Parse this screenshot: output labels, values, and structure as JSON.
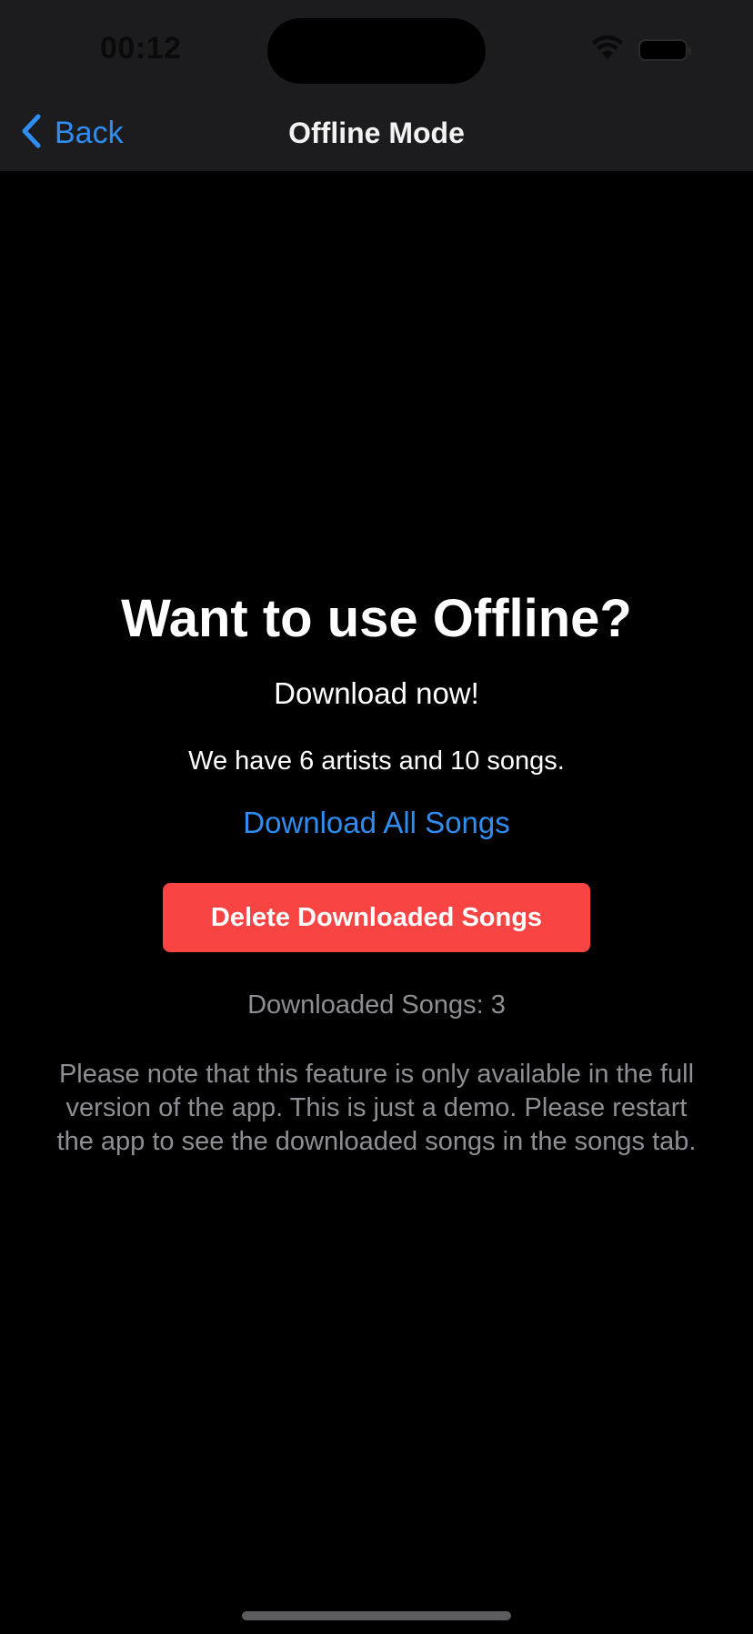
{
  "status_bar": {
    "time": "00:12",
    "icons": [
      "wifi-icon",
      "battery-icon"
    ]
  },
  "navbar": {
    "back_label": "Back",
    "back_icon": "chevron-left-icon",
    "title": "Offline Mode"
  },
  "main": {
    "headline": "Want to use Offline?",
    "subhead": "Download now!",
    "stats": "We have 6 artists and 10 songs.",
    "download_link": "Download All Songs",
    "delete_button": "Delete Downloaded Songs",
    "downloaded_count": "Downloaded Songs: 3",
    "note": "Please note that this feature is only available in the full version of the app. This is just a demo. Please restart the app to see the downloaded songs in the songs tab."
  },
  "colors": {
    "accent": "#2f8cf0",
    "destructive": "#f94444",
    "background": "#000000",
    "nav_background": "#1c1c1e",
    "secondary_text": "#8e8e93"
  }
}
